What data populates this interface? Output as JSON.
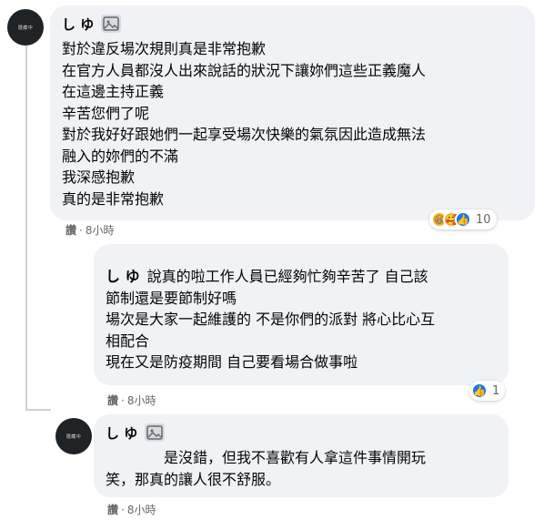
{
  "comment1": {
    "avatar_text": "隱藏中",
    "author": "し ゆ",
    "badge_icon": "sticker-icon",
    "lines": [
      "對於違反場次規則真是非常抱歉",
      "在官方人員都沒人出來說話的狀況下讓妳們這些正義魔人",
      "在這邊主持正義",
      "辛苦您們了呢",
      "對於我好好跟她們一起享受場次快樂的氣氛因此造成無法",
      "融入的妳們的不滿",
      "我深感抱歉",
      "真的是非常抱歉"
    ],
    "like_label": "讚",
    "time": "8小時",
    "reactions": {
      "icons": [
        "haha",
        "care",
        "like"
      ],
      "count": "10"
    }
  },
  "reply1": {
    "author": "し ゆ",
    "lines": [
      "說真的啦工作人員已經夠忙夠辛苦了 自己該",
      "節制還是要節制好嗎",
      "場次是大家一起維護的 不是你們的派對 將心比心互",
      "相配合",
      "現在又是防疫期間 自己要看場合做事啦"
    ],
    "like_label": "讚",
    "time": "8小時",
    "reactions": {
      "icons": [
        "like"
      ],
      "count": "1"
    }
  },
  "reply2": {
    "avatar_text": "隱藏中",
    "author": "し ゆ",
    "badge_icon": "sticker-icon",
    "lines": [
      "是沒錯，但我不喜歡有人拿這件事情開玩",
      "笑，那真的讓人很不舒服。"
    ],
    "like_label": "讚",
    "time": "8小時"
  },
  "colors": {
    "bubble": "#f0f2f5",
    "meta_text": "#65676b",
    "like_blue": "#1877f2",
    "haha_yellow": "#f7b125"
  }
}
